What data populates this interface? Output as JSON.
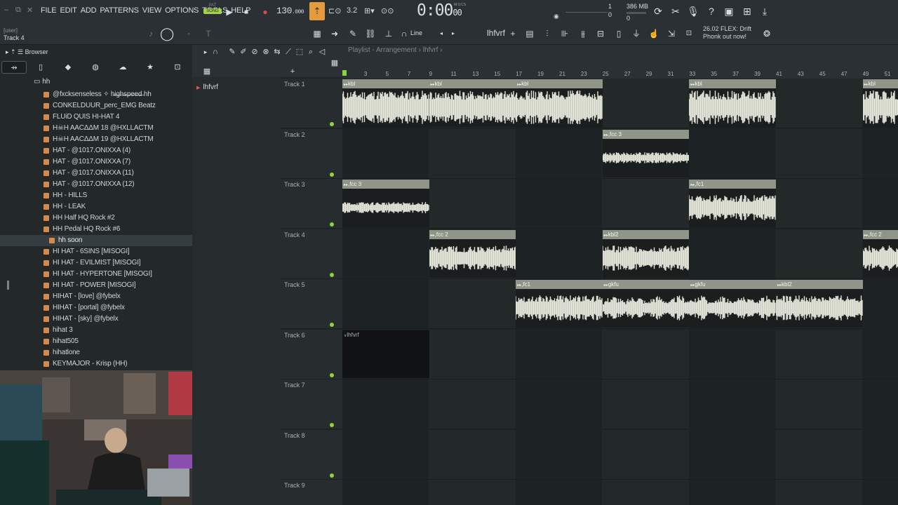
{
  "window": {
    "controls": [
      "–",
      "⧉",
      "✕"
    ]
  },
  "menu": [
    "FILE",
    "EDIT",
    "ADD",
    "PATTERNS",
    "VIEW",
    "OPTIONS",
    "TOOLS",
    "HELP"
  ],
  "transport": {
    "pat_label": "PAT",
    "song_label": "SONG",
    "tempo": "130",
    "tempo_decimals": ".000",
    "time_main": "0:00",
    "time_sub": "00",
    "time_format": "M:S:CS",
    "step_value": "3.2",
    "cpu_value": "1",
    "cpu_sub": "0",
    "memory": "386 MB",
    "memory_sub": "0"
  },
  "hint": {
    "line1": "26.02  FLEX: Drift",
    "line2": "Phonk out now!"
  },
  "user_hint": {
    "line1": "[user]",
    "line2": "Track 4"
  },
  "toolbar2": {
    "snap_mode": "Line",
    "pattern_name": "lhfvrf"
  },
  "browser": {
    "title": "Browser",
    "folder": "hh",
    "items": [
      "@fxcksenseless ✧ h̶i̶g̶h̶s̶p̶e̶e̶d̶ hh",
      "CONKELDUUR_perc_EMG Beatz",
      "FLUiD QUIS HI-HAT 4",
      "H☠H AACΔΔM 18 @HXLLACTM",
      "H☠H AACΔΔM 19 @HXLLACTM",
      "HAT - @1017.ONIXXA (4)",
      "HAT - @1017.ONIXXA (7)",
      "HAT - @1017.ONIXXA (11)",
      "HAT - @1017.ONIXXA (12)",
      "HH - HILLS",
      "HH - LEAK",
      "HH Half HQ Rock #2",
      "HH Pedal HQ Rock #6",
      "hh soon",
      "HI HAT - 6SINS [MISOGI]",
      "HI HAT - EVILMIST [MISOGI]",
      "HI HAT - HYPERTONE [MISOGI]",
      "HI HAT - POWER [MISOGI]",
      "HIHAT - [love] @fybelx",
      "HIHAT - [portal] @fybelx",
      "HIHAT - [sky] @fybelx",
      "hihat 3",
      "hihat505",
      "hihatlone",
      "KEYMAJOR - Krisp (HH)"
    ],
    "selected_index": 13
  },
  "playlist": {
    "title": "Playlist - Arrangement",
    "pattern": "lhfvrf",
    "pattern_list": [
      "lhfvrf"
    ],
    "ruler": [
      "1",
      "3",
      "5",
      "7",
      "9",
      "11",
      "13",
      "15",
      "17",
      "19",
      "21",
      "23",
      "25",
      "27",
      "29",
      "31",
      "33",
      "35",
      "37",
      "39",
      "41",
      "43",
      "45",
      "47",
      "49",
      "51"
    ],
    "tracks": [
      "Track 1",
      "Track 2",
      "Track 3",
      "Track 4",
      "Track 5",
      "Track 6",
      "Track 7",
      "Track 8",
      "Track 9"
    ],
    "clips": [
      {
        "track": 0,
        "start": 1,
        "end": 9,
        "label": "kbl"
      },
      {
        "track": 0,
        "start": 9,
        "end": 17,
        "label": "kbl"
      },
      {
        "track": 0,
        "start": 17,
        "end": 25,
        "label": "kbl"
      },
      {
        "track": 0,
        "start": 33,
        "end": 41,
        "label": "kbl"
      },
      {
        "track": 0,
        "start": 49,
        "end": 53,
        "label": "kbl"
      },
      {
        "track": 1,
        "start": 25,
        "end": 33,
        "label": ",fcc 3"
      },
      {
        "track": 2,
        "start": 1,
        "end": 9,
        "label": ",fcc 3"
      },
      {
        "track": 2,
        "start": 33,
        "end": 41,
        "label": ",fc1"
      },
      {
        "track": 3,
        "start": 9,
        "end": 17,
        "label": ",fcc 2"
      },
      {
        "track": 3,
        "start": 25,
        "end": 33,
        "label": "kbl2"
      },
      {
        "track": 3,
        "start": 49,
        "end": 53,
        "label": ",fcc 2"
      },
      {
        "track": 4,
        "start": 17,
        "end": 25,
        "label": ",fc1"
      },
      {
        "track": 4,
        "start": 25,
        "end": 33,
        "label": "gkfu"
      },
      {
        "track": 4,
        "start": 33,
        "end": 41,
        "label": "gkfu"
      },
      {
        "track": 4,
        "start": 41,
        "end": 49,
        "label": "kbl2"
      },
      {
        "track": 5,
        "start": 1,
        "end": 9,
        "label": "lhfvrf",
        "pattern": true
      }
    ]
  }
}
